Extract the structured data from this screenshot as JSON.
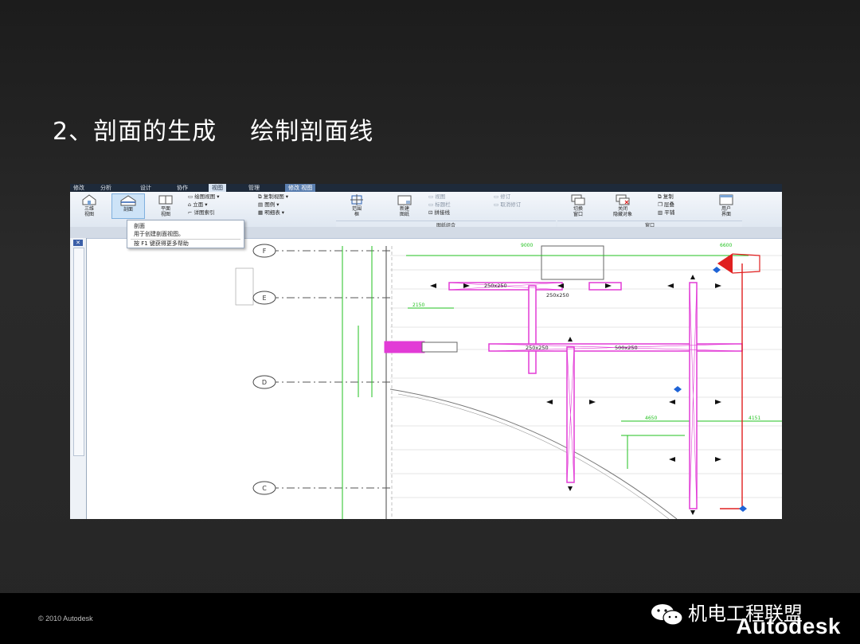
{
  "slide": {
    "title": "2、剖面的生成    绘制剖面线",
    "copyright": "© 2010 Autodesk",
    "wechat_title": "机电工程联盟",
    "autodesk_logo": "Autodesk"
  },
  "app": {
    "tabs": [
      "修改",
      "分析",
      "设计",
      "协作",
      "视图",
      "管理",
      "修改 视图"
    ],
    "active_tab": "视图",
    "ribbon": {
      "create_group": {
        "buttons": [
          {
            "label": "三维\n视图",
            "icon": "3d-house-icon"
          },
          {
            "label": "剖面",
            "icon": "section-icon"
          },
          {
            "label": "平面\n视图",
            "icon": "plan-view-icon"
          }
        ],
        "small_items": [
          "绘图视图",
          "立面",
          "详图索引",
          "复制视图",
          "图例",
          "明细表"
        ]
      },
      "sheet_group": {
        "label": "图纸组合",
        "buttons": [
          {
            "label": "范围\n框",
            "icon": "scope-box-icon"
          },
          {
            "label": "新建\n图纸",
            "icon": "new-sheet-icon"
          }
        ],
        "small_items": [
          "视图",
          "标题栏",
          "拼接线",
          "修订",
          "取消修订"
        ]
      },
      "window_group": {
        "label": "窗口",
        "buttons": [
          {
            "label": "切换\n窗口",
            "icon": "switch-window-icon"
          },
          {
            "label": "关闭\n隐藏对象",
            "icon": "close-hidden-icon"
          },
          {
            "label": "用户\n界面",
            "icon": "user-interface-icon"
          }
        ],
        "small_items": [
          "复制",
          "层叠",
          "平铺"
        ]
      }
    },
    "tooltip": {
      "title": "剖面",
      "description": "用于创建剖面视图。",
      "help": "按 F1 键获得更多帮助"
    },
    "drawing": {
      "grid_labels": [
        "F",
        "E",
        "D",
        "C"
      ],
      "duct_labels": [
        "250x250",
        "250x250",
        "250x250",
        "500x250"
      ],
      "dimensions": [
        "9000",
        "6600",
        "2150",
        "4650",
        "4151"
      ],
      "colors": {
        "duct": "#e23bd6",
        "dimension": "#22c21f",
        "section_line": "#e02020",
        "grid": "#555555"
      }
    }
  }
}
